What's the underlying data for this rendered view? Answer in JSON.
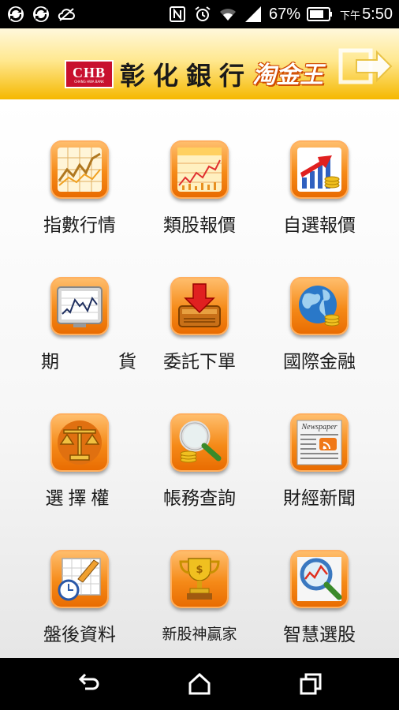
{
  "status_bar": {
    "battery": "67%",
    "time_prefix": "下午",
    "time": "5:50",
    "icons": [
      "sync-icon",
      "sync-icon",
      "cloud-off-icon",
      "nfc-icon",
      "alarm-icon",
      "wifi-icon",
      "signal-icon",
      "battery-icon"
    ]
  },
  "header": {
    "logo_text": "CHB",
    "logo_subtext": "CHANG HWA BANK",
    "bank_name": "彰化銀行",
    "app_name": "淘金王",
    "exit_icon": "exit-arrow-icon"
  },
  "menu": [
    {
      "label": "指數行情",
      "icon": "index-chart-icon"
    },
    {
      "label": "類股報價",
      "icon": "sector-chart-icon"
    },
    {
      "label": "自選報價",
      "icon": "bar-growth-icon"
    },
    {
      "label": "期　貨",
      "icon": "futures-monitor-icon"
    },
    {
      "label": "委託下單",
      "icon": "order-tray-icon"
    },
    {
      "label": "國際金融",
      "icon": "globe-coins-icon"
    },
    {
      "label": "選擇權",
      "icon": "scales-icon"
    },
    {
      "label": "帳務查詢",
      "icon": "magnifier-coins-icon"
    },
    {
      "label": "財經新聞",
      "icon": "newspaper-icon"
    },
    {
      "label": "盤後資料",
      "icon": "calendar-clock-icon"
    },
    {
      "label": "新股神贏家",
      "icon": "trophy-icon"
    },
    {
      "label": "智慧選股",
      "icon": "magnifier-chart-icon"
    }
  ],
  "newspaper_text": "Newspaper",
  "nav_bar": [
    "back-icon",
    "home-icon",
    "recents-icon"
  ],
  "colors": {
    "header_gold": "#f5b800",
    "tile_orange": "#f58a18",
    "logo_red": "#c8102e"
  }
}
